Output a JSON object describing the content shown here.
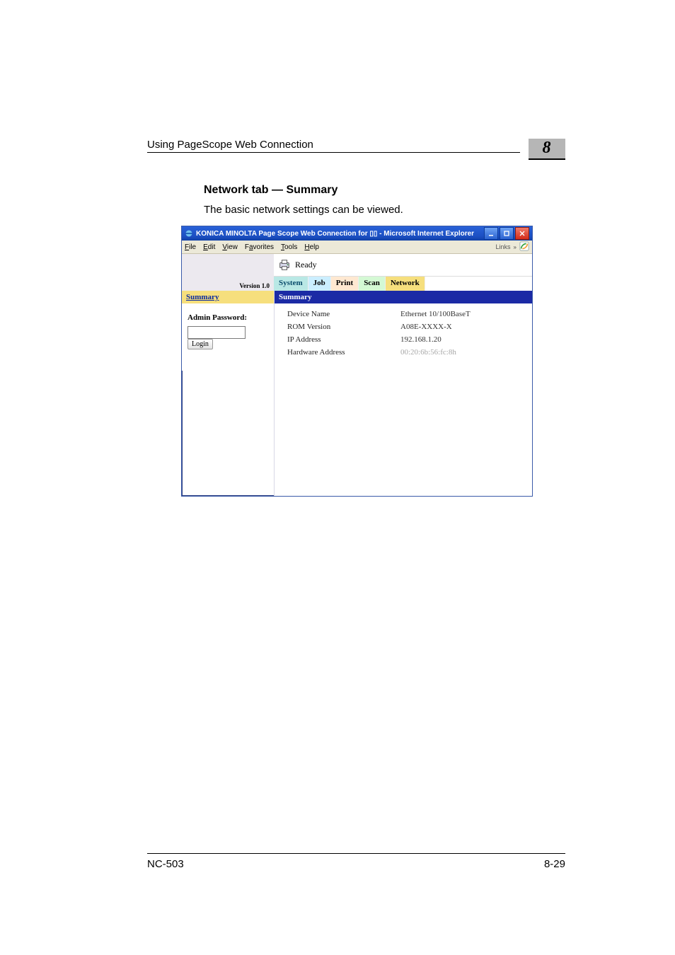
{
  "doc": {
    "running_header": "Using PageScope Web Connection",
    "chapter": "8",
    "heading": "Network tab — Summary",
    "intro": "The basic network settings can be viewed.",
    "footer_left": "NC-503",
    "footer_right": "8-29"
  },
  "browser": {
    "title": "KONICA MINOLTA Page Scope Web Connection for ▯▯ - Microsoft Internet Explorer",
    "menu": {
      "file": "File",
      "edit": "Edit",
      "view": "View",
      "favorites": "Favorites",
      "tools": "Tools",
      "help": "Help"
    },
    "links_label": "Links",
    "version_label": "Version 1.0"
  },
  "page_app": {
    "status": "Ready",
    "tabs": {
      "system": "System",
      "job": "Job",
      "print": "Print",
      "scan": "Scan",
      "network": "Network"
    },
    "side_summary": "Summary",
    "admin_label": "Admin Password:",
    "login_label": "Login",
    "panel_title": "Summary",
    "rows": {
      "device_name": {
        "label": "Device Name",
        "value": "Ethernet 10/100BaseT"
      },
      "rom_version": {
        "label": "ROM Version",
        "value": "A08E-XXXX-X"
      },
      "ip_address": {
        "label": "IP Address",
        "value": "192.168.1.20"
      },
      "hw_address": {
        "label": "Hardware Address",
        "value": "00:20:6b:56:fc:8h"
      }
    }
  }
}
